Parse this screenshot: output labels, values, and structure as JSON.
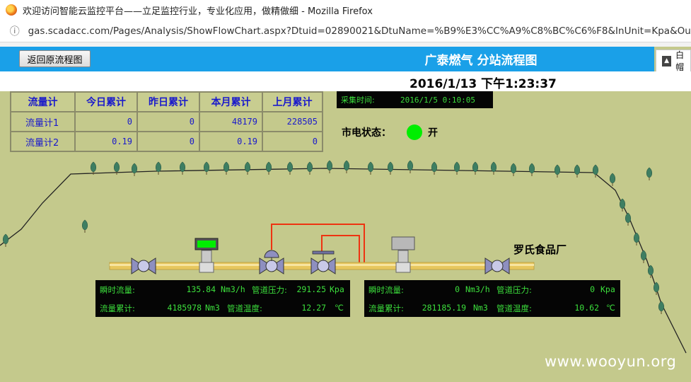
{
  "browser": {
    "window_title": "欢迎访问智能云监控平台——立足监控行业，专业化应用，做精做细 - Mozilla Firefox",
    "url": "gas.scadacc.com/Pages/Analysis/ShowFlowChart.aspx?Dtuid=02890021&DtuName=%B9%E3%CC%A9%C8%BC%C6%F8&InUnit=Kpa&OutUn"
  },
  "header": {
    "back_button": "返回原流程图",
    "title": "广泰燃气 分站流程图",
    "side_tab_label": "白帽"
  },
  "clock": "2016/1/13 下午1:23:37",
  "meter_table": {
    "headers": [
      "流量计",
      "今日累计",
      "昨日累计",
      "本月累计",
      "上月累计"
    ],
    "rows": [
      [
        "流量计1",
        "0",
        "0",
        "48179",
        "228505"
      ],
      [
        "流量计2",
        "0.19",
        "0",
        "0.19",
        "0"
      ]
    ]
  },
  "collect": {
    "label": "采集时间:",
    "value": "2016/1/5 0:10:05"
  },
  "power": {
    "label": "市电状态：",
    "state": "开",
    "color": "#00ee00"
  },
  "factory_label": "罗氏食品厂",
  "panels": [
    {
      "flow_label": "瞬时流量:",
      "flow_value": "135.84",
      "flow_unit": "Nm3/h",
      "pressure_label": "管道压力:",
      "pressure_value": "291.25",
      "pressure_unit": "Kpa",
      "total_label": "流量累计:",
      "total_value": "4185978",
      "total_unit": "Nm3",
      "temp_label": "管道温度:",
      "temp_value": "12.27",
      "temp_unit": "℃"
    },
    {
      "flow_label": "瞬时流量:",
      "flow_value": "0",
      "flow_unit": "Nm3/h",
      "pressure_label": "管道压力:",
      "pressure_value": "0",
      "pressure_unit": "Kpa",
      "total_label": "流量累计:",
      "total_value": "281185.19",
      "total_unit": "Nm3",
      "temp_label": "管道温度:",
      "temp_value": "10.62",
      "temp_unit": "℃"
    }
  ],
  "watermark": "www.wooyun.org",
  "colors": {
    "app_bar": "#1aa0e8",
    "background": "#c4c98c",
    "pipe": "#e7c75e",
    "bypass_line": "#ee3311",
    "data_green": "#3cdf3c"
  }
}
